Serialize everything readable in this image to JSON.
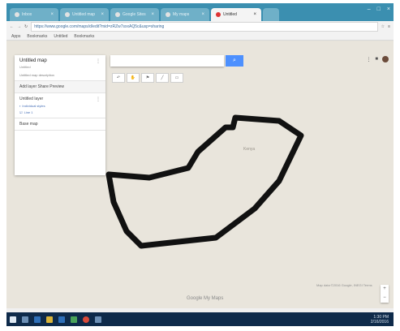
{
  "browser": {
    "tabs": [
      {
        "label": "Inbox",
        "active": false
      },
      {
        "label": "Untitled map",
        "active": false
      },
      {
        "label": "Google Sites",
        "active": false
      },
      {
        "label": "My maps",
        "active": false
      },
      {
        "label": "Untitled",
        "active": true
      },
      {
        "label": "",
        "active": false
      }
    ],
    "url": "https://www.google.com/maps/d/edit?mid=zRZw7sxxAQ5c&usp=sharing",
    "bookmarks": [
      "Apps",
      "Bookmarks",
      "Untitled",
      "Bookmarks"
    ]
  },
  "panel": {
    "map_title": "Untitled map",
    "map_subtitle": "Untitled",
    "share_link": "Untitled map description",
    "add_layer": "Add layer  Share  Preview",
    "layer_name": "Untitled layer",
    "layer_items": [
      "Individual styles",
      "Line 1"
    ],
    "base_map": "Base map"
  },
  "search": {
    "placeholder": ""
  },
  "map": {
    "place_label": "Kenya",
    "google_logo": "Google My Maps",
    "attribution": "Map data ©2016 Google, INEGI  Terms",
    "zoom_in": "+",
    "zoom_out": "−"
  },
  "taskbar": {
    "time": "1:30 PM",
    "date": "2/16/2016"
  },
  "colors": {
    "accent": "#4d90fe",
    "tabbar": "#3b8fb0",
    "taskbar": "#0e2a4a",
    "shape_stroke": "#111111"
  },
  "icons": [
    "search-icon",
    "hand-icon",
    "marker-icon",
    "line-icon",
    "directions-icon",
    "ruler-icon",
    "apps-icon",
    "bell-icon",
    "avatar"
  ]
}
